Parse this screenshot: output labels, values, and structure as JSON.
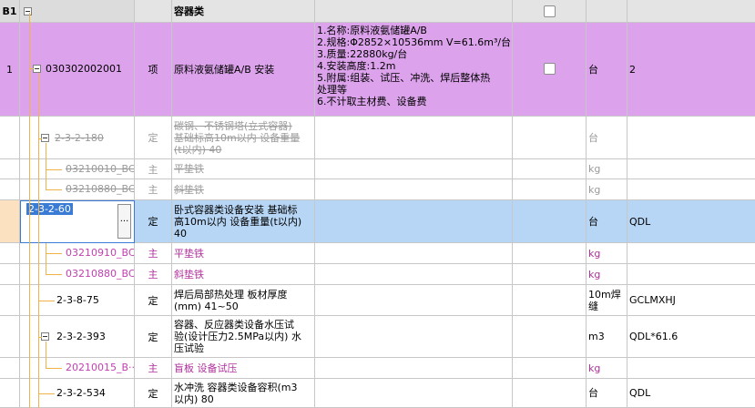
{
  "header": {
    "col0": "B1",
    "name": "容器类"
  },
  "main_row": {
    "index": "1",
    "code": "030302002001",
    "type": "项",
    "name": "原料液氨储罐A/B 安装",
    "desc_lines": [
      "1.名称:原料液氨储罐A/B",
      "2.规格:Φ2852×10536mm V=61.6m³/台",
      "3.质量:22880kg/台",
      "4.安装高度:1.2m",
      "5.附属:组装、试压、冲洗、焊后整体热",
      "处理等",
      "6.不计取主材费、设备费"
    ],
    "unit": "台",
    "qty": "2"
  },
  "rows": [
    {
      "code": "2-3-2-180",
      "type": "定",
      "name": "碳钢、不锈钢塔(立式容器)\n基础标高10m以内 设备重量\n(t以内) 40",
      "unit": "台",
      "qty": ""
    },
    {
      "code": "03210010_BC",
      "type": "主",
      "name": "平垫铁",
      "unit": "kg",
      "qty": ""
    },
    {
      "code": "03210880_BC",
      "type": "主",
      "name": "斜垫铁",
      "unit": "kg",
      "qty": ""
    },
    {
      "code": "2-3-2-60",
      "type": "定",
      "name": "卧式容器类设备安装 基础标\n高10m以内 设备重量(t以内)\n40",
      "unit": "台",
      "qty": "QDL"
    },
    {
      "code": "03210910_BC",
      "type": "主",
      "name": "平垫铁",
      "unit": "kg",
      "qty": ""
    },
    {
      "code": "03210880_BC",
      "type": "主",
      "name": "斜垫铁",
      "unit": "kg",
      "qty": ""
    },
    {
      "code": "2-3-8-75",
      "type": "定",
      "name": "焊后局部热处理 板材厚度\n(mm) 41~50",
      "unit": "10m焊\n缝",
      "qty": "GCLMXHJ"
    },
    {
      "code": "2-3-2-393",
      "type": "定",
      "name": "容器、反应器类设备水压试\n验(设计压力2.5MPa以内) 水\n压试验",
      "unit": "m3",
      "qty": "QDL*61.6"
    },
    {
      "code": "20210015_B···",
      "type": "主",
      "name": "盲板 设备试压",
      "unit": "kg",
      "qty": ""
    },
    {
      "code": "2-3-2-534",
      "type": "定",
      "name": "水冲洗 容器类设备容积(m3\n以内) 80",
      "unit": "台",
      "qty": "QDL"
    }
  ],
  "editor": {
    "ellipsis": "···"
  },
  "colors": {
    "purple_row": "#dca3ec",
    "selected_row": "#b7d6f5",
    "tree_line": "#f0b34a",
    "sub_text": "#b1309c"
  }
}
